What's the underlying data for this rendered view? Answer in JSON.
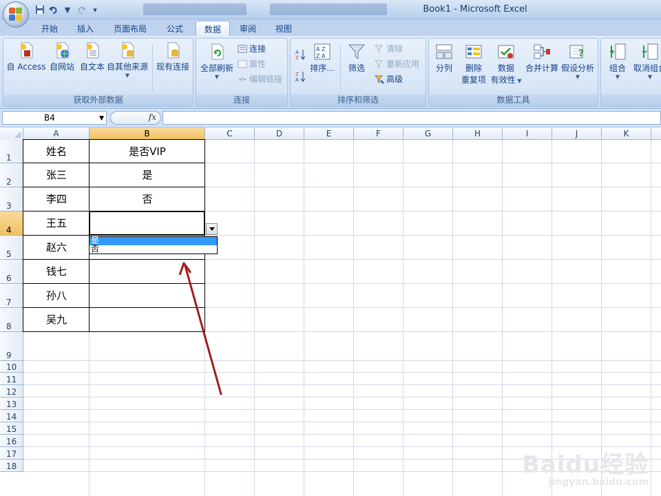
{
  "window": {
    "title": "Book1 - Microsoft Excel"
  },
  "quick_access": {
    "save_icon": "save-icon",
    "undo_icon": "undo-icon",
    "redo_icon": "redo-icon"
  },
  "ribbon_tabs": [
    "开始",
    "插入",
    "页面布局",
    "公式",
    "数据",
    "审阅",
    "视图"
  ],
  "active_tab": "数据",
  "ribbon": {
    "external_data": {
      "title": "获取外部数据",
      "access": "自 Access",
      "web": "自网站",
      "text": "自文本",
      "other": "自其他来源",
      "existing": "现有连接"
    },
    "connections": {
      "title": "连接",
      "refresh_all": "全部刷新",
      "connections": "连接",
      "properties": "属性",
      "edit_links": "编辑链接"
    },
    "sort_filter": {
      "title": "排序和筛选",
      "sort": "排序...",
      "filter": "筛选",
      "clear": "清除",
      "reapply": "重新应用",
      "advanced": "高级"
    },
    "data_tools": {
      "title": "数据工具",
      "text_to_columns": "分列",
      "remove_dup_1": "删除",
      "remove_dup_2": "重复项",
      "validation_1": "数据",
      "validation_2": "有效性",
      "consolidate": "合并计算",
      "what_if": "假设分析"
    },
    "outline": {
      "group": "组合",
      "ungroup": "取消组合"
    }
  },
  "formula_bar": {
    "name_box": "B4",
    "fx_label": "fx",
    "value": ""
  },
  "columns": [
    "A",
    "B",
    "C",
    "D",
    "E",
    "F",
    "G",
    "H",
    "I",
    "J",
    "K"
  ],
  "rows": [
    "1",
    "2",
    "3",
    "4",
    "5",
    "6",
    "7",
    "8",
    "9",
    "10",
    "11",
    "12",
    "13",
    "14",
    "15",
    "16",
    "17",
    "18"
  ],
  "selected_cell": "B4",
  "table": {
    "header": [
      "姓名",
      "是否VIP"
    ],
    "rows": [
      [
        "张三",
        "是"
      ],
      [
        "李四",
        "否"
      ],
      [
        "王五",
        ""
      ],
      [
        "赵六",
        ""
      ],
      [
        "钱七",
        ""
      ],
      [
        "孙八",
        ""
      ],
      [
        "吴九",
        ""
      ]
    ]
  },
  "dropdown": {
    "options": [
      "是",
      "否"
    ],
    "highlighted": "是"
  },
  "annotation": {
    "arrow_color": "#a01c1c"
  },
  "watermark": {
    "brand": "Baidu经验",
    "url": "jingyan.baidu.com"
  },
  "colors": {
    "selected_header": "#f1c15f",
    "highlight": "#3399ff",
    "ribbon_text": "#15428b"
  }
}
